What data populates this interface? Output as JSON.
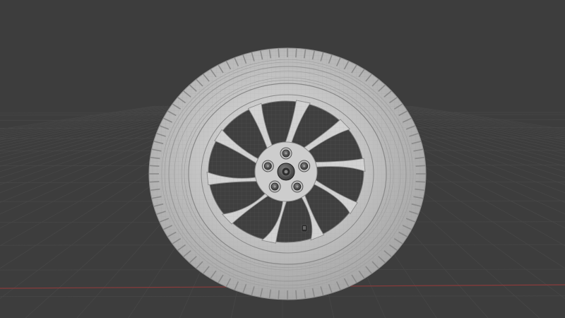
{
  "viewport": {
    "background_color": "#3d3d3d",
    "grid_color": "#474747",
    "x_axis_color": "#8a3b3b",
    "model_color": "#cfcfcf",
    "wire_color": "#7a7a7a",
    "object": "car-wheel",
    "spoke_count": 10,
    "lug_nut_count": 5,
    "shading": "solid-with-wireframe"
  }
}
